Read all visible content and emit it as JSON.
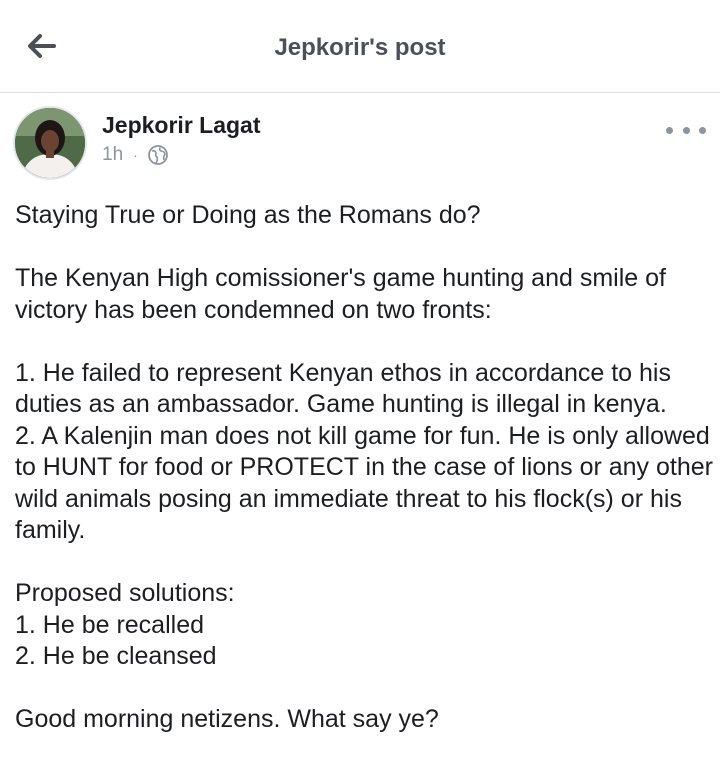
{
  "header": {
    "title": "Jepkorir's post",
    "back_icon": "arrow-left-icon"
  },
  "post": {
    "author": "Jepkorir Lagat",
    "time": "1h",
    "separator": "·",
    "privacy_icon": "globe-icon",
    "more_icon": "more-horizontal-icon",
    "paragraphs": [
      [
        "Staying True or Doing as the Romans do?"
      ],
      [
        "The Kenyan High comissioner's game hunting and smile of victory has been condemned on two fronts:"
      ],
      [
        "1. He failed to represent Kenyan ethos in accordance to his duties as an ambassador. Game hunting is illegal in kenya.",
        "2. A Kalenjin man does not kill game for fun. He is only allowed to HUNT for food or PROTECT in the case of lions or any other wild animals posing an immediate threat to his flock(s) or his family."
      ],
      [
        "Proposed solutions:",
        "1. He be recalled",
        "2. He be cleansed"
      ],
      [
        "Good morning netizens. What say ye?"
      ]
    ]
  }
}
